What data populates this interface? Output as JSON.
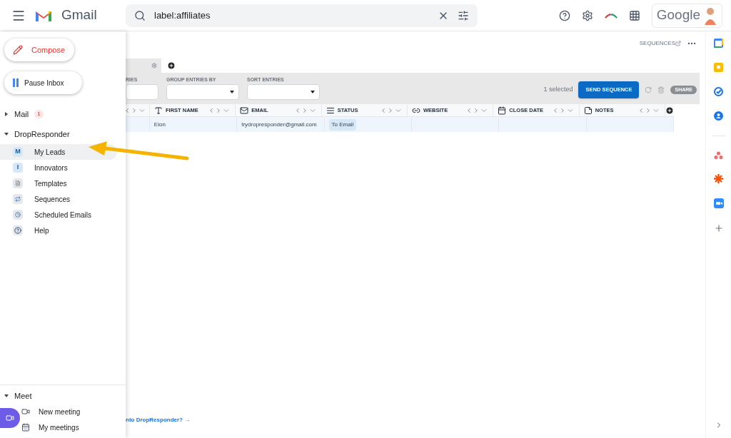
{
  "header": {
    "app_name": "Gmail",
    "search": {
      "value": "label:affiliates"
    },
    "account_label": "Google"
  },
  "sidebar": {
    "compose": "Compose",
    "pause": "Pause Inbox",
    "sections": [
      {
        "label": "Mail",
        "badge": "1",
        "expanded": false
      },
      {
        "label": "DropResponder",
        "expanded": true,
        "items": [
          {
            "label": "My Leads",
            "kind": "letter",
            "letter": "M",
            "selected": true
          },
          {
            "label": "Innovators",
            "kind": "letter",
            "letter": "I",
            "selected": false
          },
          {
            "label": "Templates",
            "kind": "template",
            "selected": false
          },
          {
            "label": "Sequences",
            "kind": "sequence",
            "selected": false
          },
          {
            "label": "Scheduled Emails",
            "kind": "clock",
            "selected": false
          },
          {
            "label": "Help",
            "kind": "help",
            "selected": false
          }
        ]
      }
    ],
    "meet": {
      "label": "Meet",
      "expanded": true,
      "items": [
        {
          "label": "New meeting",
          "kind": "new"
        },
        {
          "label": "My meetings",
          "kind": "calendar"
        }
      ]
    }
  },
  "main": {
    "sequences_link": "SEQUENCES",
    "filters": [
      {
        "label": "RIES",
        "kind": "text"
      },
      {
        "label": "GROUP ENTRIES BY",
        "kind": "select"
      },
      {
        "label": "SORT ENTRIES",
        "kind": "select"
      }
    ],
    "selection": "1 selected",
    "send_button": "SEND SEQUENCE",
    "share_button": "SHARE",
    "columns": [
      {
        "kind": "text",
        "label": "FIRST NAME"
      },
      {
        "kind": "email",
        "label": "EMAIL"
      },
      {
        "kind": "status",
        "label": "STATUS"
      },
      {
        "kind": "link",
        "label": "WEBSITE"
      },
      {
        "kind": "date",
        "label": "CLOSE DATE"
      },
      {
        "kind": "notes",
        "label": "NOTES"
      }
    ],
    "rows": [
      {
        "selected": true,
        "first_name": "Elon",
        "email": "trydropresponder@gmail.com",
        "status": "To Email"
      }
    ],
    "footer_link": "nto DropResponder? →"
  }
}
